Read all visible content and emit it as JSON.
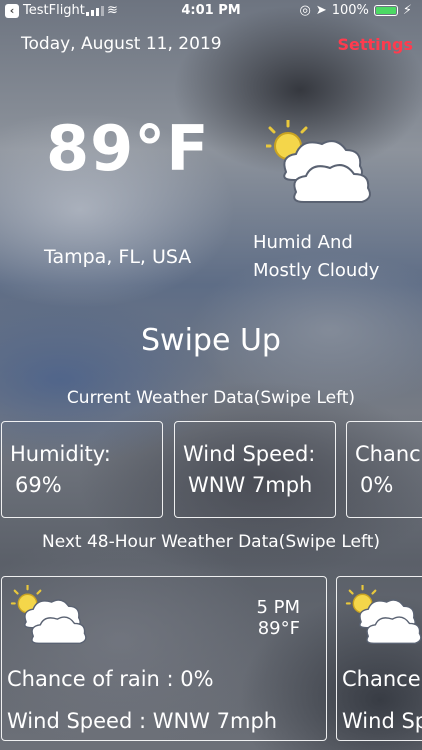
{
  "status_bar": {
    "back_app": "TestFlight",
    "time": "4:01 PM",
    "battery": "100%"
  },
  "header": {
    "date": "Today, August 11, 2019",
    "settings_label": "Settings"
  },
  "current": {
    "temperature": "89°F",
    "location": "Tampa, FL, USA",
    "condition_line1": "Humid And",
    "condition_line2": "Mostly Cloudy",
    "icon": "sun-behind-cloud-icon"
  },
  "swipe_up_label": "Swipe Up",
  "current_section_title": "Current Weather Data(Swipe Left)",
  "current_cards": [
    {
      "label": "Humidity:",
      "value": "69%"
    },
    {
      "label": "Wind Speed:",
      "value": "WNW 7mph"
    },
    {
      "label": "Chanc",
      "value": "0%"
    }
  ],
  "forecast_section_title": "Next 48-Hour Weather Data(Swipe Left)",
  "forecast_cards": [
    {
      "time": "5 PM",
      "temp": "89°F",
      "rain": "Chance of rain : 0%",
      "wind": "Wind Speed : WNW 7mph",
      "icon": "sun-behind-cloud-icon"
    },
    {
      "time": "",
      "temp": "",
      "rain": "Chance",
      "wind": "Wind Sp",
      "icon": "sun-behind-cloud-icon"
    }
  ],
  "colors": {
    "settings_accent": "#ff3b4e",
    "battery_fill": "#4cd964"
  }
}
